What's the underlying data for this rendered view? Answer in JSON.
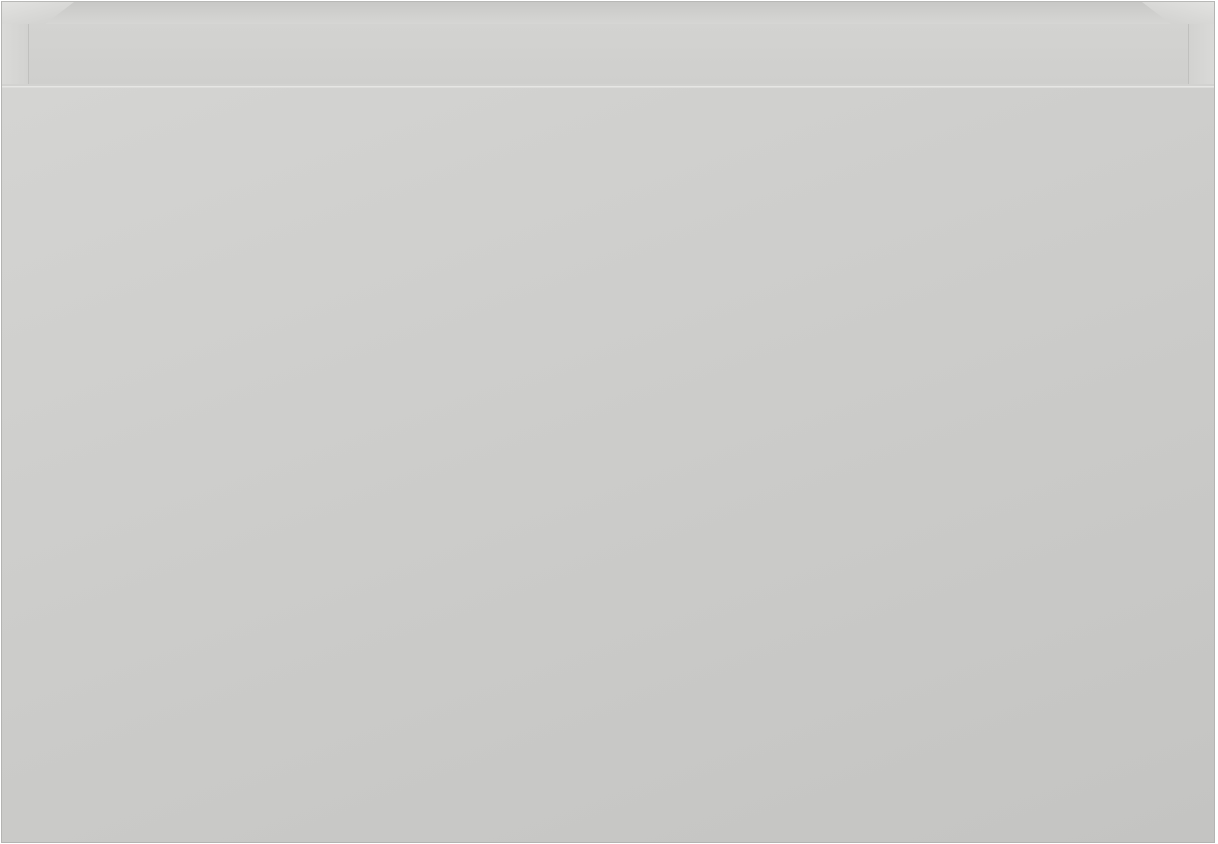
{
  "scene": {
    "subject": "",
    "colors": {
      "panel": "#cbcbc9",
      "rim": "#d2d2d0",
      "edge": "#b4b4b2",
      "background": "#ffffff"
    }
  }
}
